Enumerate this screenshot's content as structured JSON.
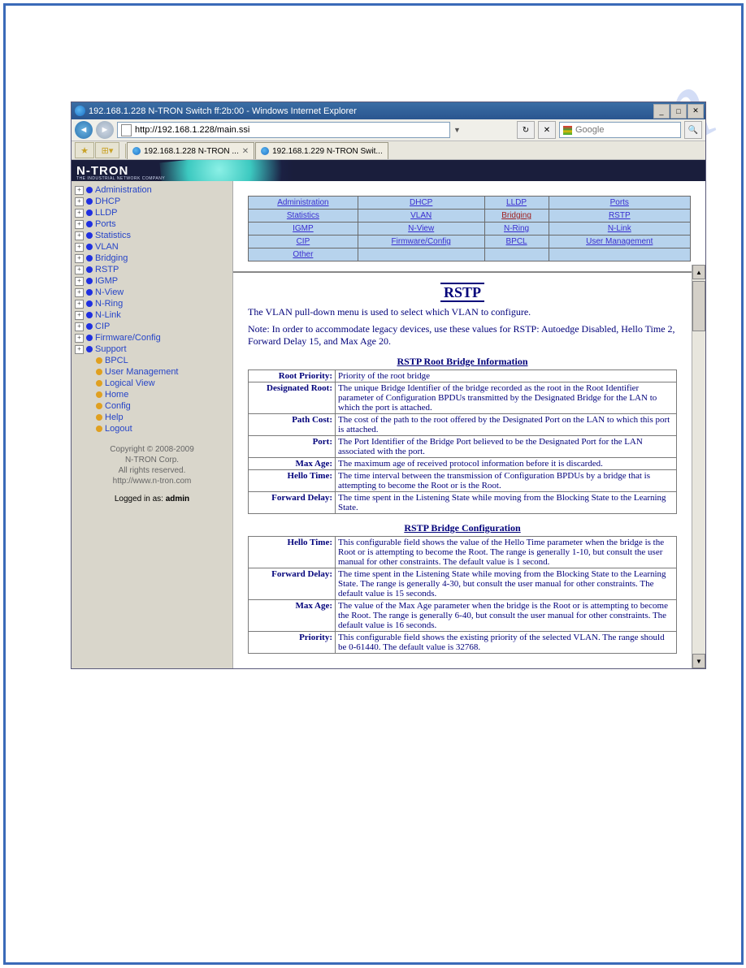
{
  "window": {
    "title": "192.168.1.228 N-TRON Switch ff:2b:00 - Windows Internet Explorer",
    "url": "http://192.168.1.228/main.ssi",
    "search_placeholder": "Google",
    "tabs": [
      {
        "label": "192.168.1.228 N-TRON ...",
        "active": true
      },
      {
        "label": "192.168.1.229 N-TRON Swit...",
        "active": false
      }
    ]
  },
  "brand": {
    "logo": "N-TRON",
    "tagline": "THE INDUSTRIAL NETWORK COMPANY"
  },
  "sidebar": {
    "items": [
      {
        "label": "Administration",
        "expand": true,
        "dot": "blue"
      },
      {
        "label": "DHCP",
        "expand": true,
        "dot": "blue"
      },
      {
        "label": "LLDP",
        "expand": true,
        "dot": "blue"
      },
      {
        "label": "Ports",
        "expand": true,
        "dot": "blue"
      },
      {
        "label": "Statistics",
        "expand": true,
        "dot": "blue"
      },
      {
        "label": "VLAN",
        "expand": true,
        "dot": "blue"
      },
      {
        "label": "Bridging",
        "expand": true,
        "dot": "blue"
      },
      {
        "label": "RSTP",
        "expand": true,
        "dot": "blue"
      },
      {
        "label": "IGMP",
        "expand": true,
        "dot": "blue"
      },
      {
        "label": "N-View",
        "expand": true,
        "dot": "blue"
      },
      {
        "label": "N-Ring",
        "expand": true,
        "dot": "blue"
      },
      {
        "label": "N-Link",
        "expand": true,
        "dot": "blue"
      },
      {
        "label": "CIP",
        "expand": true,
        "dot": "blue"
      },
      {
        "label": "Firmware/Config",
        "expand": true,
        "dot": "blue"
      },
      {
        "label": "Support",
        "expand": true,
        "dot": "blue"
      }
    ],
    "subitems": [
      {
        "label": "BPCL",
        "dot": "yel"
      },
      {
        "label": "User Management",
        "dot": "yel"
      },
      {
        "label": "Logical View",
        "dot": "yel"
      },
      {
        "label": "Home",
        "dot": "yel"
      },
      {
        "label": "Config",
        "dot": "yel"
      },
      {
        "label": "Help",
        "dot": "yel"
      },
      {
        "label": "Logout",
        "dot": "yel"
      }
    ],
    "copyright": {
      "line1": "Copyright © 2008-2009",
      "line2": "N-TRON Corp.",
      "line3": "All rights reserved.",
      "link": "http://www.n-tron.com"
    },
    "logged_in_prefix": "Logged in as: ",
    "logged_in_user": "admin"
  },
  "navtable": {
    "rows": [
      [
        "Administration",
        "DHCP",
        "LLDP",
        "Ports"
      ],
      [
        "Statistics",
        "VLAN",
        "Bridging",
        "RSTP"
      ],
      [
        "IGMP",
        "N-View",
        "N-Ring",
        "N-Link"
      ],
      [
        "CIP",
        "Firmware/Config",
        "BPCL",
        "User Management"
      ],
      [
        "Other",
        "",
        "",
        ""
      ]
    ],
    "bridging_red": true
  },
  "content": {
    "heading": "RSTP",
    "intro": "The VLAN pull-down menu is used to select which VLAN to configure.",
    "note": "Note: In order to accommodate legacy devices, use these values for RSTP: Autoedge Disabled, Hello Time 2, Forward Delay 15, and Max Age 20.",
    "section1_title": "RSTP Root Bridge Information",
    "section1": [
      {
        "label": "Root Priority:",
        "text": "Priority of the root bridge"
      },
      {
        "label": "Designated Root:",
        "text": "The unique Bridge Identifier of the bridge recorded as the root in the Root Identifier parameter of Configuration BPDUs transmitted by the Designated Bridge for the LAN to which the port is attached."
      },
      {
        "label": "Path Cost:",
        "text": "The cost of the path to the root offered by the Designated Port on the LAN to which this port is attached."
      },
      {
        "label": "Port:",
        "text": "The Port Identifier of the Bridge Port believed to be the Designated Port for the LAN associated with the port."
      },
      {
        "label": "Max Age:",
        "text": "The maximum age of received protocol information before it is discarded."
      },
      {
        "label": "Hello Time:",
        "text": "The time interval between the transmission of Configuration BPDUs by a bridge that is attempting to become the Root or is the Root."
      },
      {
        "label": "Forward Delay:",
        "text": "The time spent in the Listening State while moving from the Blocking State to the Learning State."
      }
    ],
    "section2_title": "RSTP Bridge Configuration",
    "section2": [
      {
        "label": "Hello Time:",
        "text": "This configurable field shows the value of the Hello Time parameter when the bridge is the Root or is attempting to become the Root. The range is generally 1-10, but consult the user manual for other constraints. The default value is 1 second."
      },
      {
        "label": "Forward Delay:",
        "text": "The time spent in the Listening State while moving from the Blocking State to the Learning State. The range is generally 4-30, but consult the user manual for other constraints. The default value is 15 seconds."
      },
      {
        "label": "Max Age:",
        "text": "The value of the Max Age parameter when the bridge is the Root or is attempting to become the Root. The range is generally 6-40, but consult the user manual for other constraints. The default value is 16 seconds."
      },
      {
        "label": "Priority:",
        "text": "This configurable field shows the existing priority of the selected VLAN. The range should be 0-61440. The default value is 32768."
      }
    ]
  },
  "watermark": "manualslib.com"
}
